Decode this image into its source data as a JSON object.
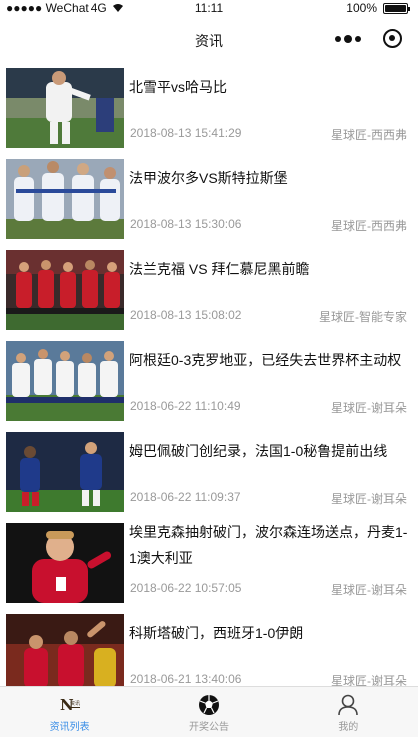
{
  "status_bar": {
    "carrier": "●●●●● WeChat",
    "network": "4G",
    "time": "11:11",
    "battery": "100%",
    "battery_level": 1.0
  },
  "nav": {
    "title": "资讯"
  },
  "news": [
    {
      "title": "北雪平vs哈马比",
      "time": "2018-08-13 15:41:29",
      "source": "星球匠-西西弗"
    },
    {
      "title": "法甲波尔多VS斯特拉斯堡",
      "time": "2018-08-13 15:30:06",
      "source": "星球匠-西西弗"
    },
    {
      "title": "法兰克福 VS 拜仁慕尼黑前瞻",
      "time": "2018-08-13 15:08:02",
      "source": "星球匠-智能专家"
    },
    {
      "title": "阿根廷0-3克罗地亚，已经失去世界杯主动权",
      "time": "2018-06-22 11:10:49",
      "source": "星球匠-谢耳朵"
    },
    {
      "title": "姆巴佩破门创纪录，法国1-0秘鲁提前出线",
      "time": "2018-06-22 11:09:37",
      "source": "星球匠-谢耳朵"
    },
    {
      "title": "埃里克森抽射破门，波尔森连场送点，丹麦1-1澳大利亚",
      "time": "2018-06-22 10:57:05",
      "source": "星球匠-谢耳朵"
    },
    {
      "title": "科斯塔破门，西班牙1-0伊朗",
      "time": "2018-06-21 13:40:06",
      "source": "星球匠-谢耳朵"
    }
  ],
  "tabs": [
    {
      "label": "资讯列表",
      "icon": "news-logo-icon",
      "logo_text": "N",
      "logo_sub": "资讯"
    },
    {
      "label": "开奖公告",
      "icon": "soccer-ball-icon"
    },
    {
      "label": "我的",
      "icon": "person-icon"
    }
  ],
  "colors": {
    "active_tab": "#3a8ee6",
    "inactive_tab": "#999999",
    "meta_text": "#999999"
  }
}
